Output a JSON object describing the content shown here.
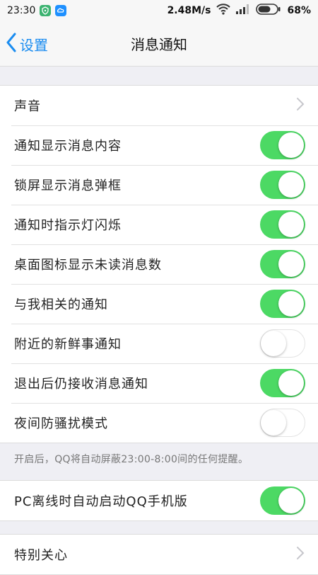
{
  "status_bar": {
    "time": "23:30",
    "speed": "2.48M/s",
    "battery": "68%",
    "battery_level": 0.68,
    "icons": [
      "app-shield-icon",
      "app-cloud-icon",
      "wifi-icon",
      "signal-icon",
      "battery-icon"
    ]
  },
  "nav": {
    "back_label": "设置",
    "title": "消息通知"
  },
  "colors": {
    "accent": "#1a8cf0",
    "toggle_on": "#4cd964",
    "background": "#efeff4"
  },
  "settings": [
    {
      "label": "声音",
      "control": "chevron"
    },
    {
      "label": "通知显示消息内容",
      "control": "toggle",
      "on": true
    },
    {
      "label": "锁屏显示消息弹框",
      "control": "toggle",
      "on": true
    },
    {
      "label": "通知时指示灯闪烁",
      "control": "toggle",
      "on": true
    },
    {
      "label": "桌面图标显示未读消息数",
      "control": "toggle",
      "on": true
    },
    {
      "label": "与我相关的通知",
      "control": "toggle",
      "on": true
    },
    {
      "label": "附近的新鲜事通知",
      "control": "toggle",
      "on": false
    },
    {
      "label": "退出后仍接收消息通知",
      "control": "toggle",
      "on": true
    },
    {
      "label": "夜间防骚扰模式",
      "control": "toggle",
      "on": false
    }
  ],
  "night_note": "开启后，QQ将自动屏蔽23:00-8:00间的任何提醒。",
  "pc_setting": {
    "label": "PC离线时自动启动QQ手机版",
    "on": true
  },
  "special_care": {
    "label": "特别关心"
  }
}
